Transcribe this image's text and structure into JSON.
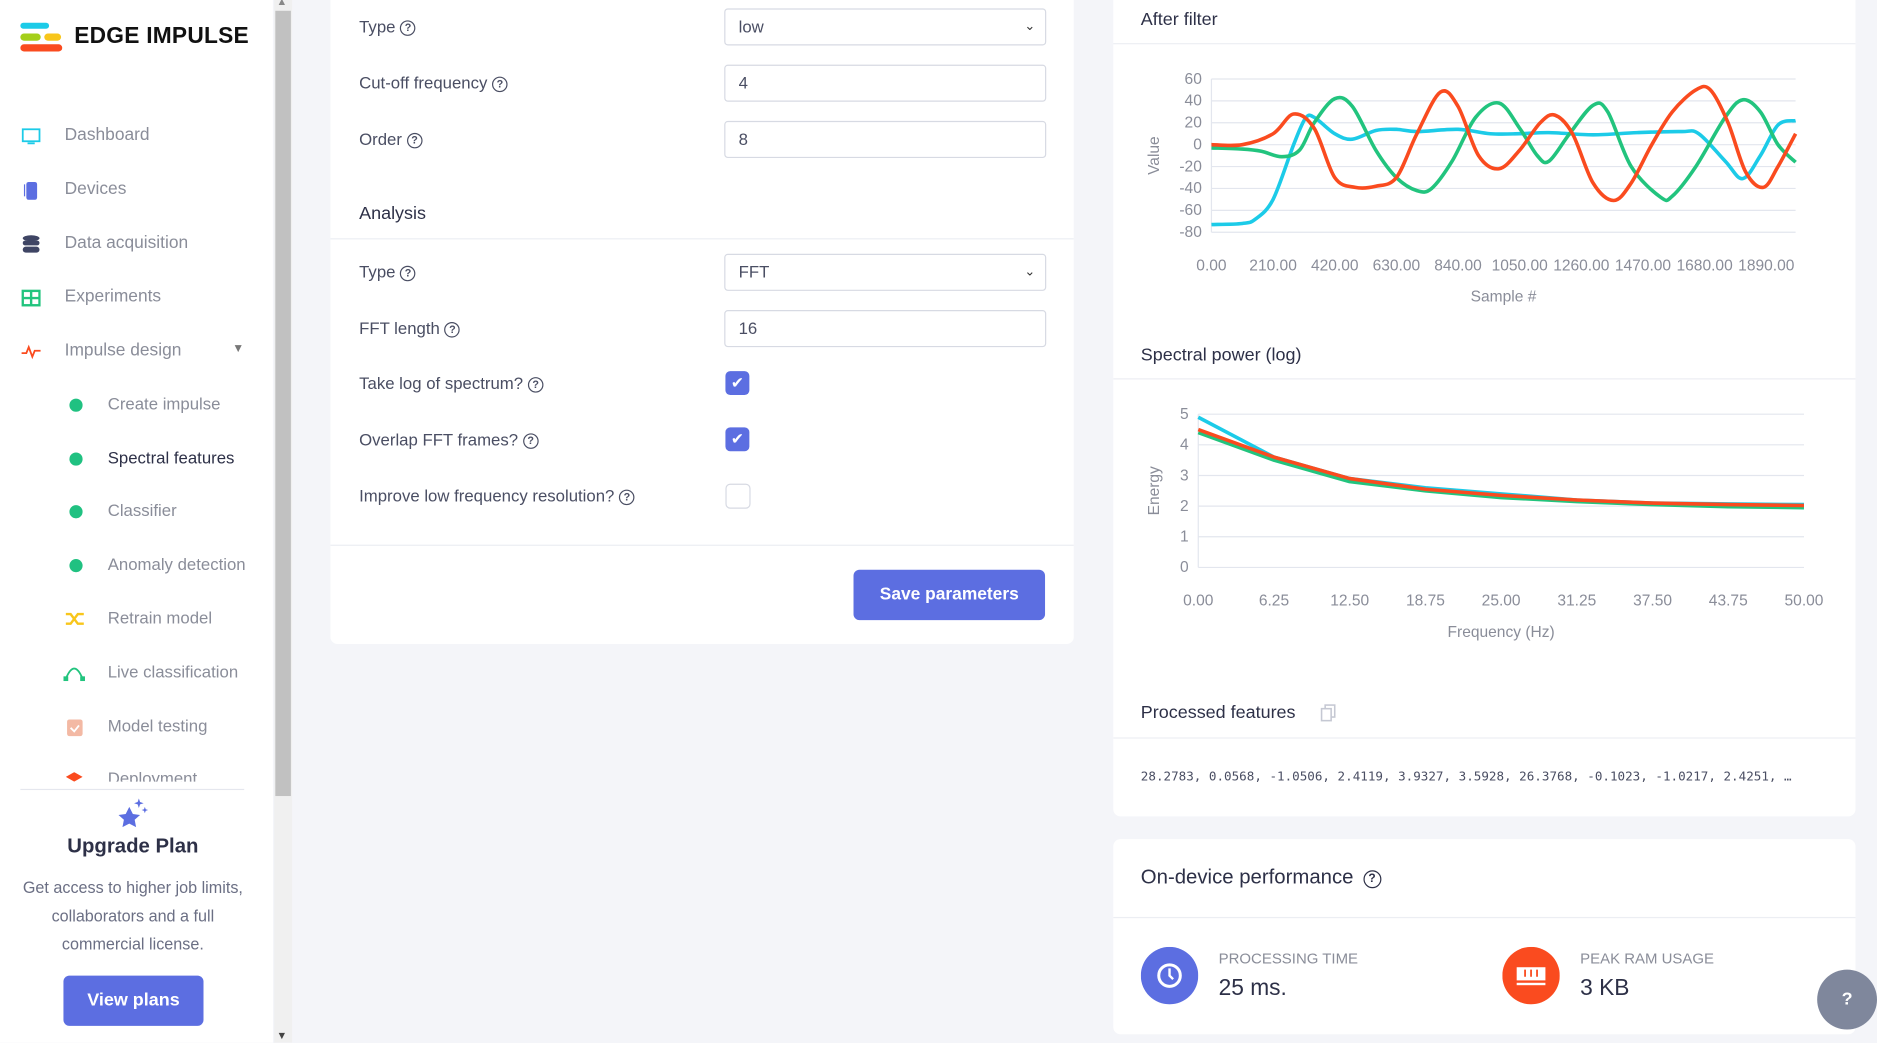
{
  "brand": {
    "name": "EDGE IMPULSE"
  },
  "sidebar": {
    "items": [
      {
        "label": "Dashboard",
        "icon": "monitor-icon"
      },
      {
        "label": "Devices",
        "icon": "chip-icon"
      },
      {
        "label": "Data acquisition",
        "icon": "database-icon"
      },
      {
        "label": "Experiments",
        "icon": "grid-icon"
      },
      {
        "label": "Impulse design",
        "icon": "pulse-icon"
      }
    ],
    "subitems": [
      {
        "label": "Create impulse",
        "icon": "dot-icon"
      },
      {
        "label": "Spectral features",
        "icon": "dot-icon",
        "active": true
      },
      {
        "label": "Classifier",
        "icon": "dot-icon"
      },
      {
        "label": "Anomaly detection",
        "icon": "dot-icon"
      },
      {
        "label": "Retrain model",
        "icon": "shuffle-icon"
      },
      {
        "label": "Live classification",
        "icon": "vector-icon"
      },
      {
        "label": "Model testing",
        "icon": "clipboard-check-icon"
      },
      {
        "label": "Deployment",
        "icon": "box-icon"
      }
    ]
  },
  "upgrade": {
    "title": "Upgrade Plan",
    "text": "Get access to higher job limits, collaborators and a full commercial license.",
    "button": "View plans"
  },
  "filter": {
    "type_label": "Type",
    "type_value": "low",
    "cutoff_label": "Cut-off frequency",
    "cutoff_value": "4",
    "order_label": "Order",
    "order_value": "8"
  },
  "analysis": {
    "heading": "Analysis",
    "type_label": "Type",
    "type_value": "FFT",
    "fft_label": "FFT length",
    "fft_value": "16",
    "log_label": "Take log of spectrum?",
    "log_checked": true,
    "overlap_label": "Overlap FFT frames?",
    "overlap_checked": true,
    "improve_label": "Improve low frequency resolution?",
    "improve_checked": false
  },
  "save_button": "Save parameters",
  "colors": {
    "accent": "#5c6ee1",
    "cyan": "#1ccbe8",
    "green": "#22c47e",
    "red": "#fa4b1f"
  },
  "chart_data": [
    {
      "type": "line",
      "title": "After filter",
      "xlabel": "Sample #",
      "ylabel": "Value",
      "xlim": [
        0,
        1990
      ],
      "ylim": [
        -80,
        60
      ],
      "xticks": [
        "0.00",
        "210.00",
        "420.00",
        "630.00",
        "840.00",
        "1050.00",
        "1260.00",
        "1470.00",
        "1680.00",
        "1890.00"
      ],
      "yticks": [
        "60",
        "40",
        "20",
        "0",
        "-20",
        "-40",
        "-60",
        "-80"
      ],
      "grid": true,
      "series": [
        {
          "color": "#1ccbe8",
          "x": [
            0,
            105,
            150,
            210,
            280,
            320,
            350,
            420,
            480,
            560,
            630,
            700,
            840,
            950,
            1050,
            1150,
            1300,
            1450,
            1600,
            1660,
            1750,
            1810,
            1870,
            1930,
            1990
          ],
          "y": [
            -73,
            -72,
            -68,
            -50,
            0,
            24,
            25,
            10,
            5,
            13,
            14,
            12,
            14,
            10,
            10,
            11,
            9,
            11,
            12,
            10,
            -15,
            -31,
            -10,
            18,
            22
          ]
        },
        {
          "color": "#22c47e",
          "x": [
            0,
            105,
            170,
            240,
            300,
            350,
            420,
            480,
            560,
            630,
            700,
            750,
            820,
            900,
            980,
            1050,
            1110,
            1150,
            1220,
            1300,
            1350,
            1430,
            1530,
            1570,
            1650,
            1750,
            1810,
            1870,
            1930,
            1990
          ],
          "y": [
            -3,
            -4,
            -6,
            -11,
            -5,
            20,
            42,
            35,
            -5,
            -30,
            -42,
            -40,
            -15,
            25,
            38,
            15,
            -10,
            -15,
            10,
            36,
            30,
            -20,
            -48,
            -47,
            -20,
            25,
            41,
            30,
            0,
            -16
          ]
        },
        {
          "color": "#fa4b1f",
          "x": [
            0,
            105,
            210,
            280,
            350,
            420,
            490,
            560,
            630,
            700,
            780,
            840,
            910,
            980,
            1050,
            1120,
            1170,
            1230,
            1300,
            1370,
            1430,
            1500,
            1570,
            1650,
            1700,
            1760,
            1820,
            1880,
            1930,
            1990
          ],
          "y": [
            0,
            0,
            10,
            28,
            15,
            -30,
            -39,
            -38,
            -30,
            10,
            48,
            35,
            -10,
            -22,
            -5,
            20,
            27,
            10,
            -35,
            -51,
            -35,
            0,
            30,
            50,
            50,
            20,
            -25,
            -39,
            -20,
            10
          ]
        }
      ]
    },
    {
      "type": "line",
      "title": "Spectral power (log)",
      "xlabel": "Frequency (Hz)",
      "ylabel": "Energy",
      "xlim": [
        0,
        50
      ],
      "ylim": [
        0,
        5
      ],
      "xticks": [
        "0.00",
        "6.25",
        "12.50",
        "18.75",
        "25.00",
        "31.25",
        "37.50",
        "43.75",
        "50.00"
      ],
      "yticks": [
        "5",
        "4",
        "3",
        "2",
        "1",
        "0"
      ],
      "grid": true,
      "series": [
        {
          "color": "#1ccbe8",
          "x": [
            0,
            6.25,
            12.5,
            18.75,
            25,
            31.25,
            37.5,
            43.75,
            50
          ],
          "y": [
            4.9,
            3.6,
            2.9,
            2.6,
            2.4,
            2.2,
            2.1,
            2.07,
            2.05
          ]
        },
        {
          "color": "#22c47e",
          "x": [
            0,
            6.25,
            12.5,
            18.75,
            25,
            31.25,
            37.5,
            43.75,
            50
          ],
          "y": [
            4.4,
            3.5,
            2.8,
            2.5,
            2.28,
            2.15,
            2.05,
            1.98,
            1.95
          ]
        },
        {
          "color": "#fa4b1f",
          "x": [
            0,
            6.25,
            12.5,
            18.75,
            25,
            31.25,
            37.5,
            43.75,
            50
          ],
          "y": [
            4.5,
            3.6,
            2.9,
            2.55,
            2.35,
            2.2,
            2.1,
            2.05,
            2.02
          ]
        }
      ]
    }
  ],
  "processed": {
    "title": "Processed features",
    "values": "28.2783, 0.0568, -1.0506, 2.4119, 3.9327, 3.5928, 26.3768, -0.1023, -1.0217, 2.4251, …"
  },
  "performance": {
    "title": "On-device performance",
    "time_label": "PROCESSING TIME",
    "time_value": "25 ms.",
    "ram_label": "PEAK RAM USAGE",
    "ram_value": "3 KB"
  }
}
